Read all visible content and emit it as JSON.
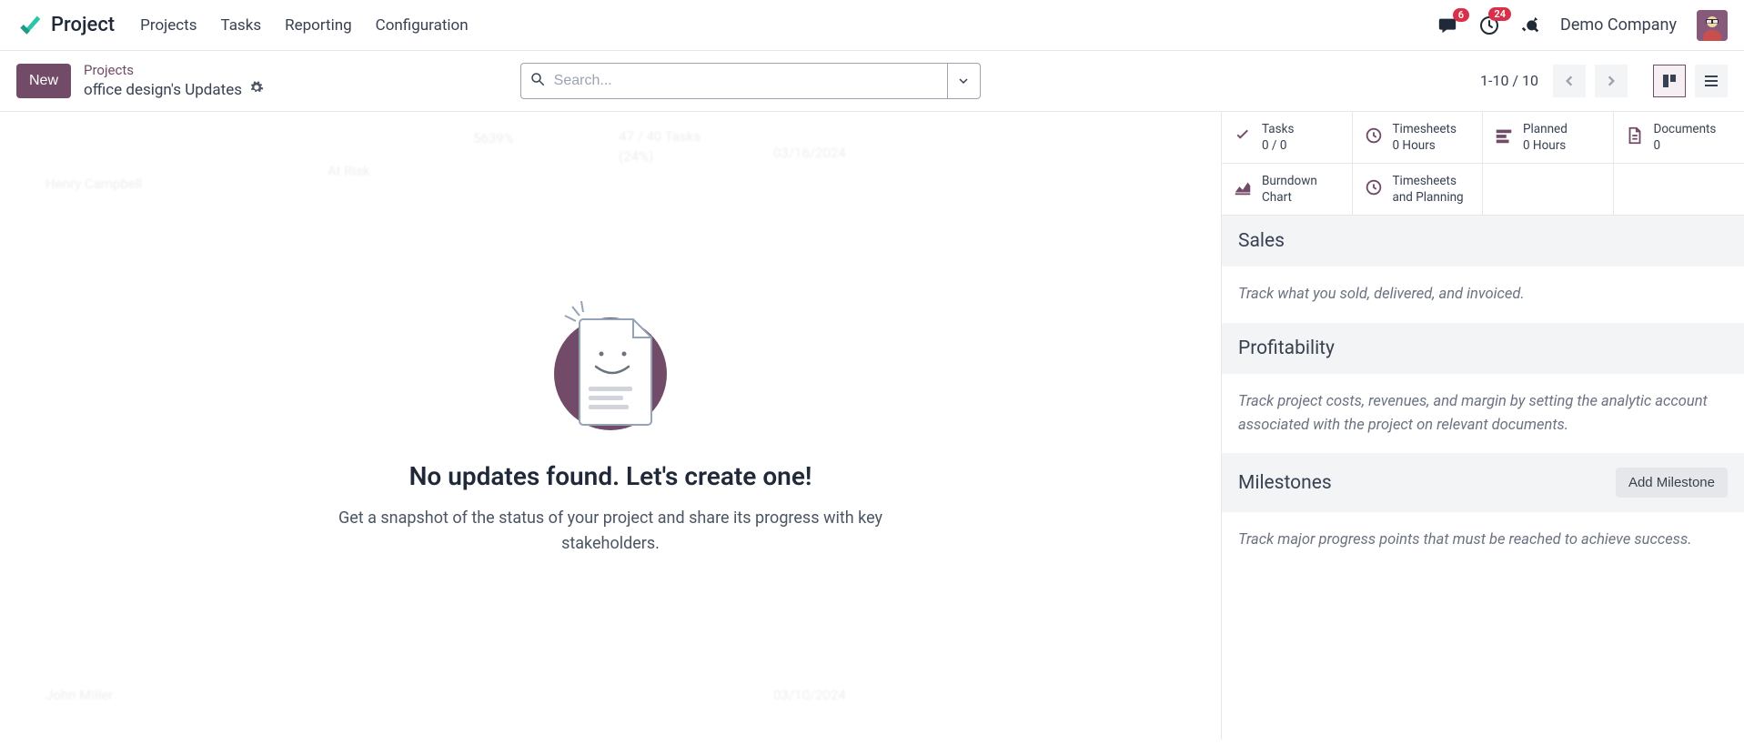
{
  "nav": {
    "app_title": "Project",
    "items": [
      "Projects",
      "Tasks",
      "Reporting",
      "Configuration"
    ],
    "messages_badge": "6",
    "activities_badge": "24",
    "company": "Demo Company"
  },
  "control": {
    "new_label": "New",
    "breadcrumb_parent": "Projects",
    "breadcrumb_title": "office design's Updates",
    "search_placeholder": "Search...",
    "paging": "1-10 / 10"
  },
  "empty_state": {
    "heading": "No updates found. Let's create one!",
    "subtext": "Get a snapshot of the status of your project and share its progress with key stakeholders."
  },
  "stats": {
    "tasks": {
      "label": "Tasks",
      "value": "0 / 0"
    },
    "timesheets": {
      "label": "Timesheets",
      "value": "0 Hours"
    },
    "planned": {
      "label": "Planned",
      "value": "0 Hours"
    },
    "documents": {
      "label": "Documents",
      "value": "0"
    },
    "burndown": {
      "label1": "Burndown",
      "label2": "Chart"
    },
    "ts_plan": {
      "label1": "Timesheets",
      "label2": "and Planning"
    }
  },
  "sections": {
    "sales": {
      "title": "Sales",
      "body": "Track what you sold, delivered, and invoiced."
    },
    "profitability": {
      "title": "Profitability",
      "body": "Track project costs, revenues, and margin by setting the analytic account associated with the project on relevant documents."
    },
    "milestones": {
      "title": "Milestones",
      "button": "Add Milestone",
      "body": "Track major progress points that must be reached to achieve success."
    }
  },
  "bg_hints": {
    "pct": "5639%",
    "tasks_line": "47 / 40 Tasks",
    "tasks_pct": "(24%)",
    "date1": "03/16/2024",
    "date2": "03/10/2024",
    "risk": "At Risk",
    "name1": "Henry Campbell",
    "name2": "John Miller"
  }
}
